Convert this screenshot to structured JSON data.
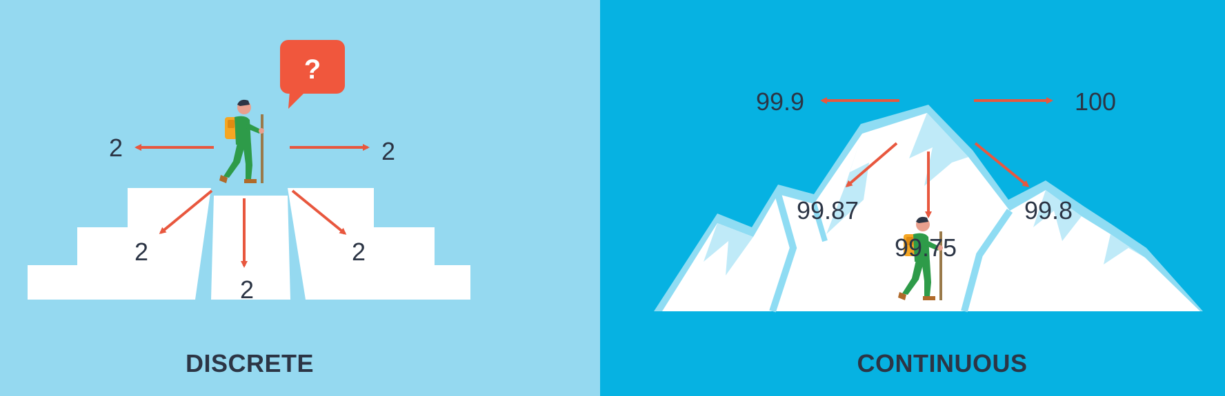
{
  "colors": {
    "left_background": "#95d9f0",
    "right_background": "#06b2e2",
    "arrow": "#e8573e",
    "text": "#2c3545",
    "snow": "#ffffff",
    "snow_shadow": "#8fdcf3",
    "speech_bubble": "#f0573d"
  },
  "discrete": {
    "caption": "DISCRETE",
    "question_mark": "?",
    "labels": {
      "left": "2",
      "right": "2",
      "down_left": "2",
      "down_center": "2",
      "down_right": "2"
    }
  },
  "continuous": {
    "caption": "CONTINUOUS",
    "labels": {
      "left": "99.9",
      "right": "100",
      "down_left": "99.87",
      "down_center": "99.75",
      "down_right": "99.8"
    }
  },
  "icons": [
    "hiker-icon",
    "speech-bubble-icon",
    "steps-block",
    "mountain-icon"
  ]
}
